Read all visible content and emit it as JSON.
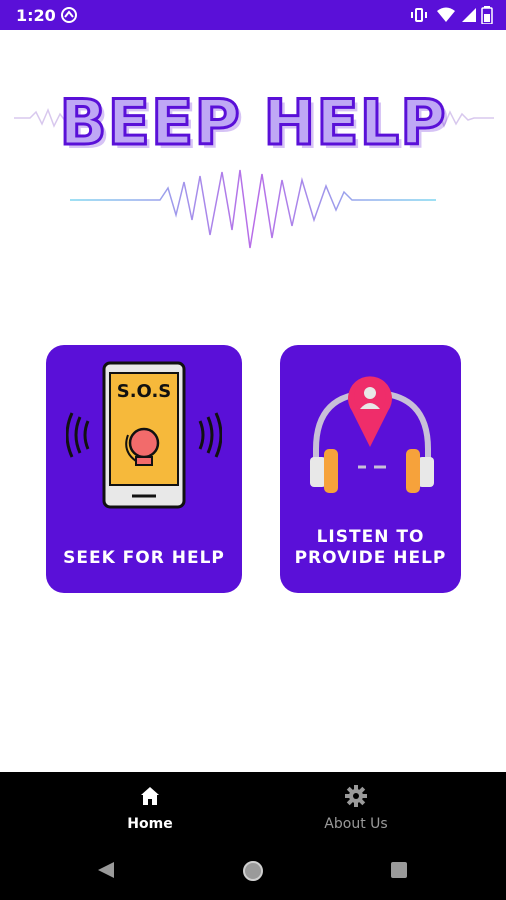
{
  "status_bar": {
    "time": "1:20",
    "icons": [
      "sync-icon",
      "vibrate-icon",
      "wifi-icon",
      "signal-icon",
      "battery-icon"
    ]
  },
  "logo": {
    "title": "BEEP HELP"
  },
  "cards": {
    "seek": {
      "label": "SEEK FOR HELP",
      "art_text": "S.O.S"
    },
    "listen": {
      "label_line1": "LISTEN TO",
      "label_line2": "PROVIDE HELP"
    }
  },
  "bottom_nav": {
    "items": [
      {
        "label": "Home",
        "icon": "home-icon",
        "active": true
      },
      {
        "label": "About Us",
        "icon": "gear-icon",
        "active": false
      }
    ]
  },
  "system_nav": {
    "buttons": [
      "back-icon",
      "home-circle-icon",
      "recents-icon"
    ]
  },
  "colors": {
    "accent": "#5a10d8",
    "logo_fill": "#bfa8f5",
    "nav_bg": "#000000"
  }
}
